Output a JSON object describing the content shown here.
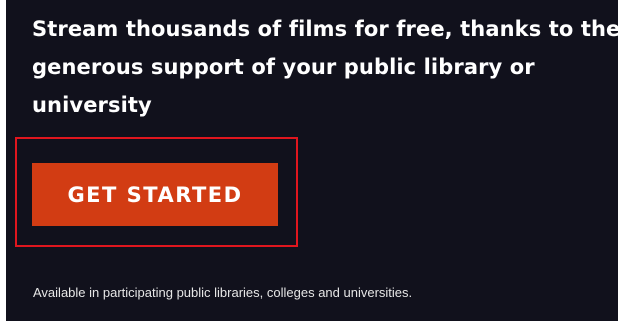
{
  "hero": {
    "headline": "Stream thousands of films for free, thanks to the generous support of your public library or university",
    "cta_label": "GET STARTED",
    "availability_note": "Available in participating public libraries, colleges and universities."
  },
  "colors": {
    "background": "#11111c",
    "cta_background": "#d23c13",
    "highlight_outline": "#e0161e",
    "text": "#ffffff"
  }
}
